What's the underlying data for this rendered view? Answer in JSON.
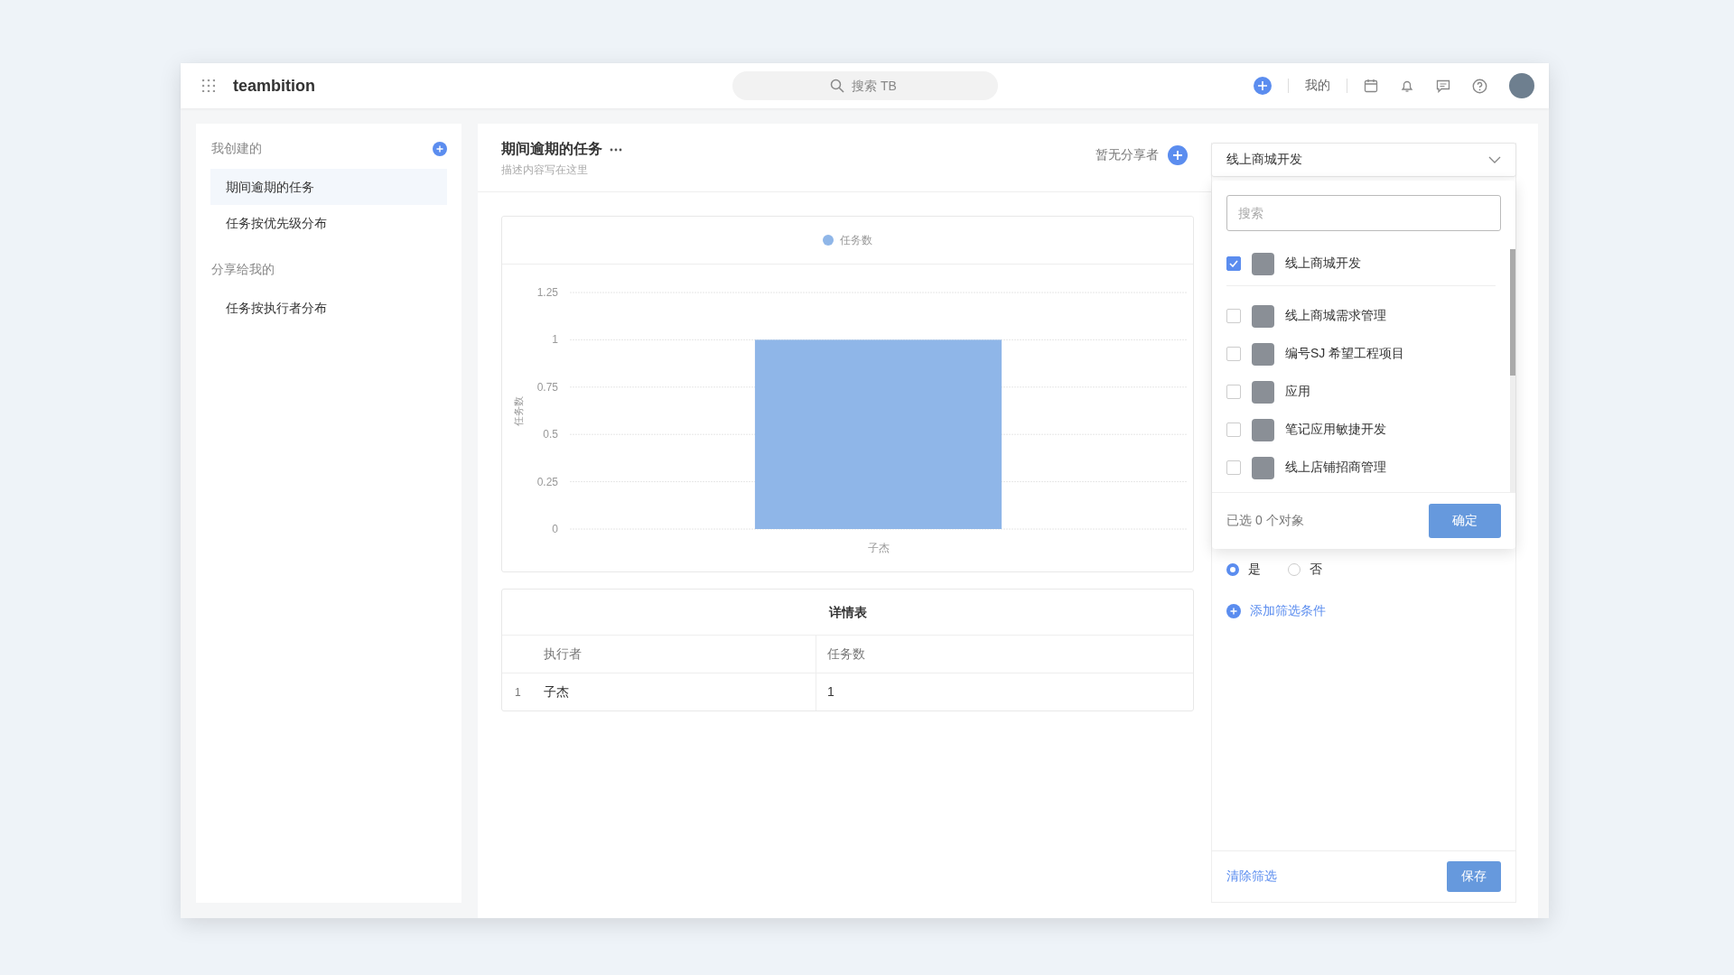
{
  "header": {
    "logo": "teambition",
    "search_placeholder": "搜索 TB",
    "user_label": "我的"
  },
  "sidebar": {
    "sections": [
      {
        "title": "我创建的",
        "can_add": true,
        "items": [
          {
            "label": "期间逾期的任务",
            "selected": true
          },
          {
            "label": "任务按优先级分布",
            "selected": false
          }
        ]
      },
      {
        "title": "分享给我的",
        "can_add": false,
        "items": [
          {
            "label": "任务按执行者分布",
            "selected": false
          }
        ]
      }
    ]
  },
  "report": {
    "title": "期间逾期的任务",
    "description": "描述内容写在这里",
    "share_label": "暂无分享者",
    "chart_data": {
      "type": "bar",
      "ylabel": "任务数",
      "categories": [
        "子杰"
      ],
      "series": [
        {
          "name": "任务数",
          "color": "#8fb6e8",
          "values": [
            1
          ]
        }
      ],
      "ylim": [
        0,
        1.25
      ],
      "grid": true,
      "yticks": [
        0,
        0.25,
        0.5,
        0.75,
        1,
        1.25
      ]
    },
    "table": {
      "title": "详情表",
      "columns": [
        "执行者",
        "任务数"
      ],
      "rows": [
        {
          "index": "1",
          "cells": [
            "子杰",
            "1"
          ]
        }
      ]
    }
  },
  "filter": {
    "project_select": "线上商城开发",
    "popup": {
      "search_placeholder": "搜索",
      "options": [
        {
          "label": "线上商城开发",
          "checked": true,
          "kind": "current"
        },
        {
          "label": "线上商城需求管理",
          "checked": false,
          "kind": "other"
        },
        {
          "label": "编号SJ 希望工程项目",
          "checked": false,
          "kind": "other"
        },
        {
          "label": "应用",
          "checked": false,
          "kind": "other"
        },
        {
          "label": "笔记应用敏捷开发",
          "checked": false,
          "kind": "other"
        },
        {
          "label": "线上店铺招商管理",
          "checked": false,
          "kind": "other"
        }
      ],
      "selected_count": "已选 0 个对象",
      "confirm": "确定"
    },
    "radios": [
      {
        "label": "是",
        "selected": true
      },
      {
        "label": "否",
        "selected": false
      }
    ],
    "add_condition": "添加筛选条件",
    "clear": "清除筛选",
    "save": "保存"
  }
}
